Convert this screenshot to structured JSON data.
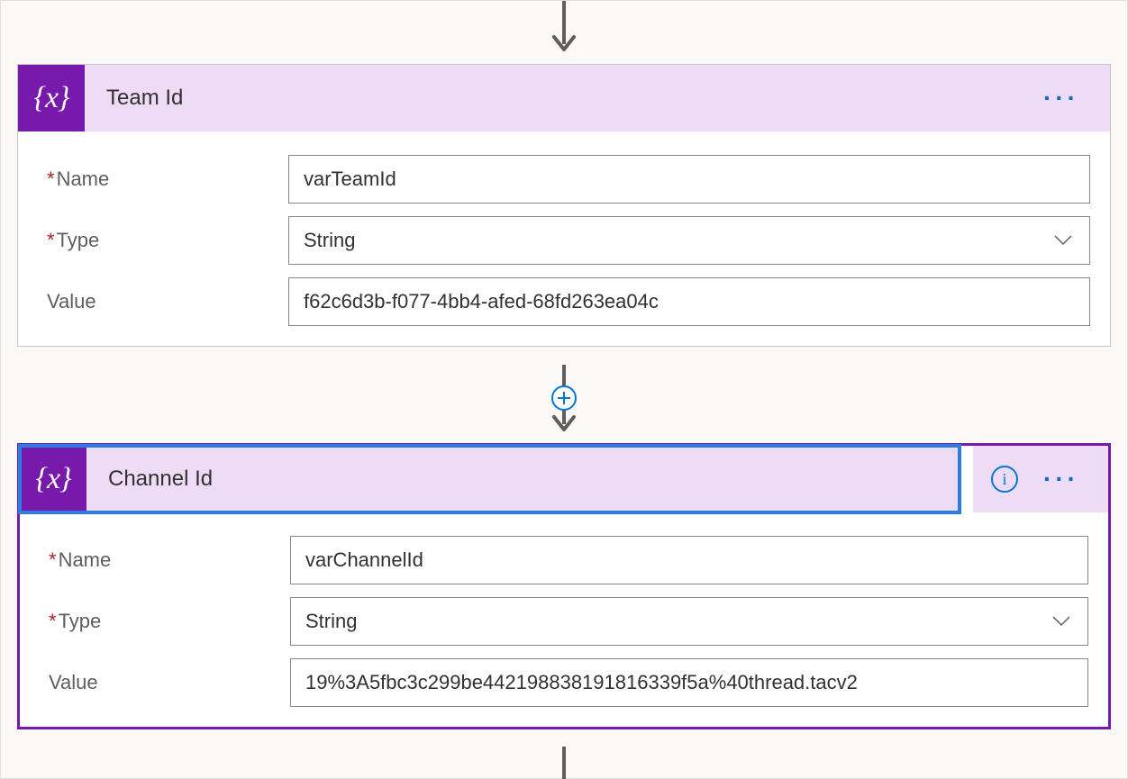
{
  "labels": {
    "name": "Name",
    "type": "Type",
    "value": "Value"
  },
  "cards": [
    {
      "id": "team",
      "title": "Team Id",
      "name": "varTeamId",
      "type": "String",
      "value": "f62c6d3b-f077-4bb4-afed-68fd263ea04c",
      "selected": false,
      "showInfo": false
    },
    {
      "id": "channel",
      "title": "Channel Id",
      "name": "varChannelId",
      "type": "String",
      "value": "19%3A5fbc3c299be442198838191816339f5a%40thread.tacv2",
      "selected": true,
      "showInfo": true
    }
  ]
}
